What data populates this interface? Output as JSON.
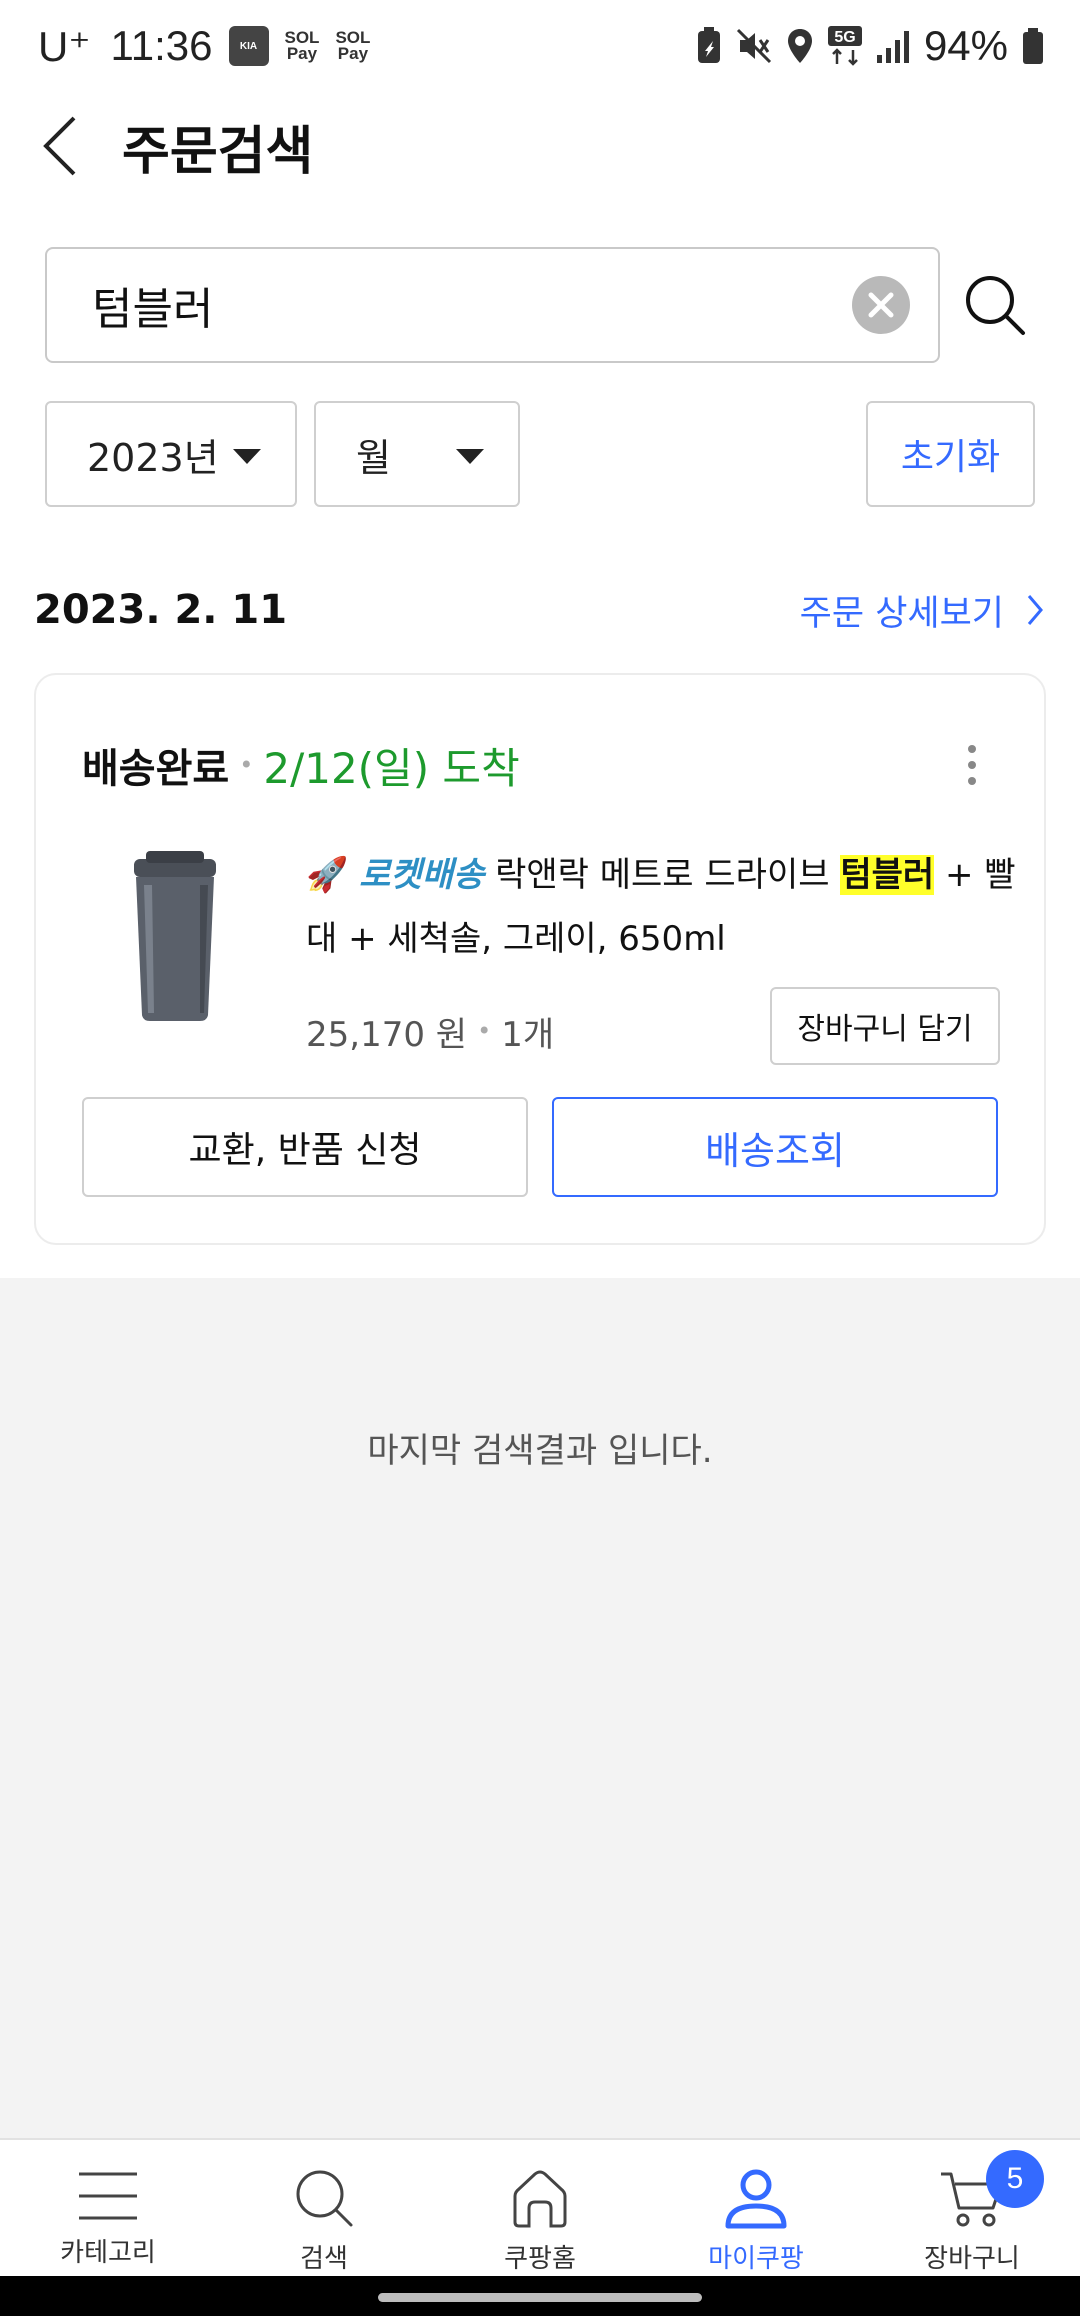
{
  "status_bar": {
    "carrier": "U⁺",
    "time": "11:36",
    "apps": [
      "Connect",
      "SOL Pay",
      "SOL Pay"
    ],
    "network": "5G",
    "battery_percent": "94%"
  },
  "header": {
    "title": "주문검색"
  },
  "search": {
    "value": "텀블러",
    "placeholder": ""
  },
  "filters": {
    "year": "2023년",
    "month": "월",
    "reset_label": "초기화"
  },
  "order_group": {
    "date": "2023. 2. 11",
    "detail_link": "주문 상세보기"
  },
  "order": {
    "status": "배송완료",
    "arrival": "2/12(일) 도착",
    "rocket_label": "로켓배송",
    "title_before": "락앤락 메트로 드라이브",
    "title_highlight": "텀블러",
    "title_after": "+ 빨대 + 세척솔, 그레이, 650ml",
    "price": "25,170 원",
    "quantity": "1개",
    "cart_button": "장바구니 담기",
    "exchange_button": "교환, 반품 신청",
    "track_button": "배송조회"
  },
  "end_message": "마지막 검색결과 입니다.",
  "bottom_nav": {
    "items": [
      {
        "label": "카테고리",
        "icon": "menu-icon"
      },
      {
        "label": "검색",
        "icon": "search-icon"
      },
      {
        "label": "쿠팡홈",
        "icon": "home-icon"
      },
      {
        "label": "마이쿠팡",
        "icon": "user-icon",
        "active": true
      },
      {
        "label": "장바구니",
        "icon": "cart-icon"
      }
    ],
    "cart_badge": "5"
  },
  "colors": {
    "accent": "#346aff",
    "delivered_green": "#1d9a2d",
    "highlight": "#ffff2a",
    "rocket_blue": "#2d8fc4"
  }
}
